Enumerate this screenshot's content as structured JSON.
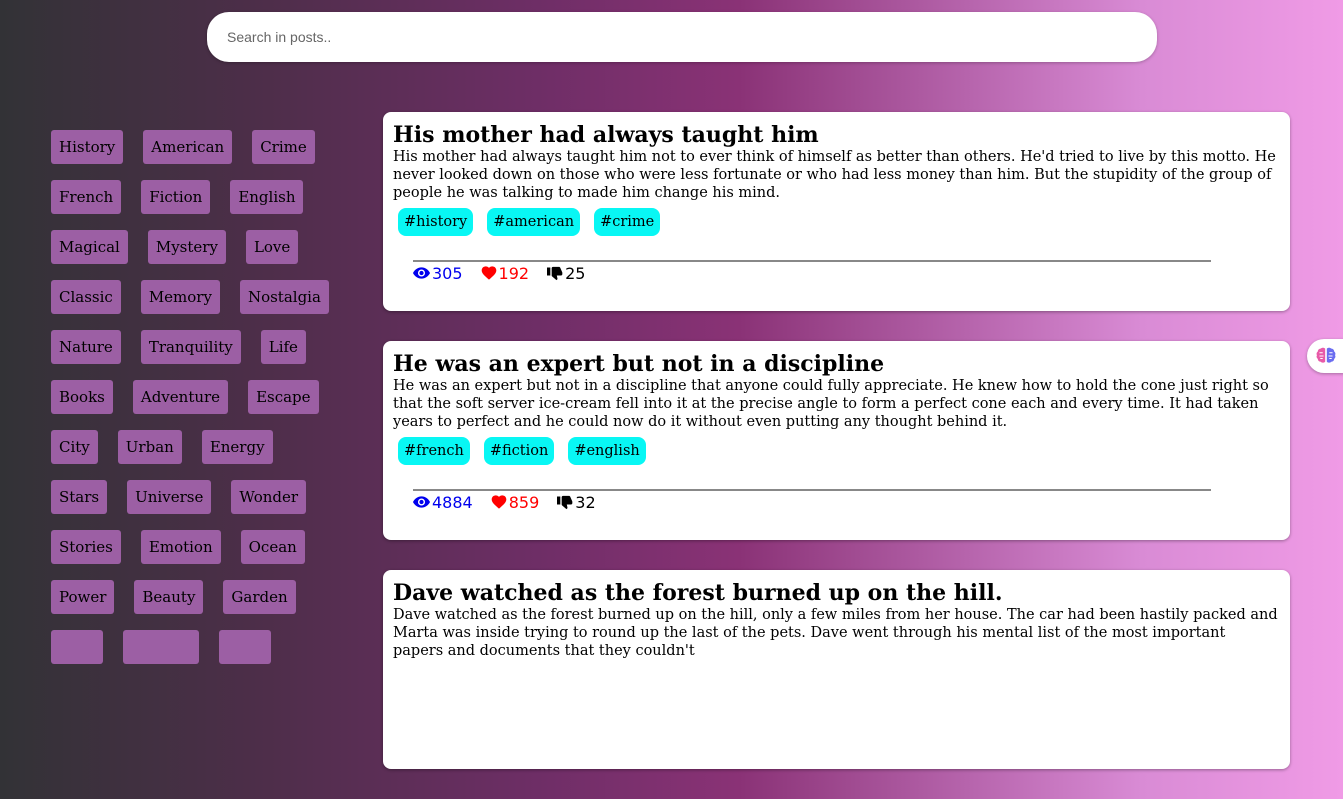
{
  "search": {
    "placeholder": "Search in posts.."
  },
  "sidebar_tags": [
    [
      "History",
      "American",
      "Crime"
    ],
    [
      "French",
      "Fiction",
      "English"
    ],
    [
      "Magical",
      "Mystery",
      "Love"
    ],
    [
      "Classic",
      "Memory",
      "Nostalgia"
    ],
    [
      "Nature",
      "Tranquility",
      "Life"
    ],
    [
      "Books",
      "Adventure",
      "Escape"
    ],
    [
      "City",
      "Urban",
      "Energy"
    ],
    [
      "Stars",
      "Universe",
      "Wonder"
    ],
    [
      "Stories",
      "Emotion",
      "Ocean"
    ],
    [
      "Power",
      "Beauty",
      "Garden"
    ]
  ],
  "posts": [
    {
      "title": "His mother had always taught him",
      "body": "His mother had always taught him not to ever think of himself as better than others. He'd tried to live by this motto. He never looked down on those who were less fortunate or who had less money than him. But the stupidity of the group of people he was talking to made him change his mind.",
      "tags": [
        "#history",
        "#american",
        "#crime"
      ],
      "views": "305",
      "likes": "192",
      "dislikes": "25"
    },
    {
      "title": "He was an expert but not in a discipline",
      "body": "He was an expert but not in a discipline that anyone could fully appreciate. He knew how to hold the cone just right so that the soft server ice-cream fell into it at the precise angle to form a perfect cone each and every time. It had taken years to perfect and he could now do it without even putting any thought behind it.",
      "tags": [
        "#french",
        "#fiction",
        "#english"
      ],
      "views": "4884",
      "likes": "859",
      "dislikes": "32"
    },
    {
      "title": "Dave watched as the forest burned up on the hill.",
      "body": "Dave watched as the forest burned up on the hill, only a few miles from her house. The car had been hastily packed and Marta was inside trying to round up the last of the pets. Dave went through his mental list of the most important papers and documents that they couldn't",
      "tags": [],
      "views": "",
      "likes": "",
      "dislikes": ""
    }
  ],
  "colors": {
    "tag_bg": "#9c5fa4",
    "post_tag_bg": "#08f7f4",
    "views": "#0000ee",
    "likes": "#ff0000"
  },
  "icons": [
    "eye-icon",
    "heart-icon",
    "thumbs-down-icon",
    "brain-icon"
  ]
}
